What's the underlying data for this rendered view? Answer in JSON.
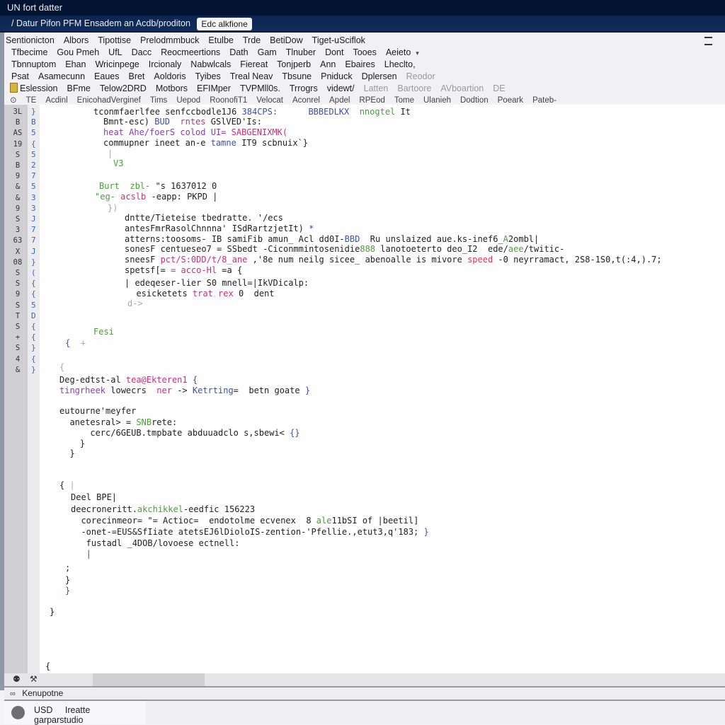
{
  "window": {
    "title": "UN fort datter",
    "path": "/ Datur Pifon PFM Ensadem an Acdb/proditon",
    "path_chip": "Edc alkfione"
  },
  "menus": {
    "row1": [
      "Sentionicton",
      "Albors",
      "Tipottise",
      "Prelodmmbuck",
      "Etulbe",
      "Trde",
      "BetiDow",
      "Tiget-uSciflok"
    ],
    "row2": [
      "Tfbecime",
      "Gou Pmeh",
      "UfL",
      "Dacc",
      "Reocmeertions",
      "Dath",
      "Gam",
      "Tlnuber",
      "Dont",
      "Tooes",
      "Aeieto"
    ],
    "row3": [
      "Tbnnuptom",
      "Ehan",
      "Wricinpege",
      "Ircionaly",
      "Nabwlcals",
      "Fiereat",
      "Tonjperb",
      "Ann",
      "Ebaires",
      "Lheclto,"
    ],
    "row4": [
      "Psat",
      "Asamecunn",
      "Eaues",
      "Bret",
      "Aoldoris",
      "Tyibes",
      "Treal Neav",
      "Tbsune",
      "Pniduck",
      "Dplersen"
    ],
    "row4_muted": [
      "Reodor"
    ],
    "row5": [
      "Eslession",
      "BFme",
      "Telow2DRD",
      "Motbors",
      "EFIMper",
      "TVPMll0s.",
      "Trrogrs",
      "videwt/"
    ],
    "row5_muted": [
      "Latten",
      "Bartoore",
      "AVboartion",
      "DE"
    ],
    "row6": [
      "TE",
      "Acdinl",
      "EnicohadVerginef",
      "Tims",
      "Uepod",
      "RoonofiT1",
      "Velocat",
      "Aconrel",
      "Apdel",
      "RPEod",
      "Tome",
      "Ulanieh",
      "Dodtion",
      "Poeark",
      "Pateb-"
    ]
  },
  "gutter": {
    "line_numbers": [
      "3L",
      "B",
      "AS",
      "19",
      "S",
      "B",
      "9",
      "&",
      "&",
      "9",
      "S",
      "3",
      "63",
      "X",
      "08",
      "S",
      "S",
      "9",
      "S",
      "T",
      "S",
      "+",
      "S",
      "4",
      "&"
    ]
  },
  "code": [
    {
      "id": "l1",
      "segments": [
        [
          "",
          "tconmfaerlfee senfccbodle1J6 "
        ],
        [
          "kw",
          "384CPS:"
        ],
        [
          "",
          "      "
        ],
        [
          "kw",
          "BBBEDLKX"
        ],
        [
          "",
          "  "
        ],
        [
          "gr",
          "nnogtel"
        ],
        [
          "",
          " It"
        ]
      ]
    },
    {
      "id": "l2",
      "segments": [
        [
          "",
          "Bmnt-esc) "
        ],
        [
          "kw",
          "BUD"
        ],
        [
          "",
          "  "
        ],
        [
          "pk",
          "rntes"
        ],
        [
          "",
          " GSlVED'Is:"
        ]
      ]
    },
    {
      "id": "l3",
      "segments": [
        [
          "pu",
          "heat Ahe/foerS colod UI= "
        ],
        [
          "pk",
          "SABGENIXMK("
        ]
      ]
    },
    {
      "id": "l4",
      "segments": [
        [
          "",
          "commupner ineet an-e "
        ],
        [
          "kw",
          "tamne"
        ],
        [
          "",
          " IT9 scbnuix`}"
        ]
      ]
    },
    {
      "id": "l5",
      "segments": [
        [
          "gy",
          "|"
        ]
      ]
    },
    {
      "id": "l6",
      "segments": [
        [
          "gr",
          "V3"
        ]
      ]
    },
    {
      "id": "l7",
      "segments": [
        [
          "gr",
          "Burt  zbl-"
        ],
        [
          "",
          " \"s 1637012 0"
        ]
      ]
    },
    {
      "id": "l8",
      "segments": [
        [
          "gr",
          "\"eg-"
        ],
        [
          "",
          ""
        ],
        [
          "pk",
          " acslb"
        ],
        [
          "",
          " -eapp: PKPD |"
        ]
      ]
    },
    {
      "id": "l9",
      "segments": [
        [
          "gy",
          "})"
        ]
      ]
    },
    {
      "id": "l10",
      "segments": [
        [
          "",
          "dntte/Tieteise tbedratte. '/ecs"
        ]
      ]
    },
    {
      "id": "l11",
      "segments": [
        [
          "",
          "antesFmrRasolChnnna' ISdRartzjetIt) "
        ],
        [
          "kw",
          "*"
        ]
      ]
    },
    {
      "id": "l12",
      "segments": [
        [
          "",
          "atterns:toosoms- IB samiFib amun_ Acl dd0I-"
        ],
        [
          "kw",
          "BBD"
        ],
        [
          "",
          "  Ru unslaized aue.ks-inef6_"
        ],
        [
          "gr",
          "A"
        ],
        [
          "",
          "2ombl|"
        ]
      ]
    },
    {
      "id": "l13",
      "segments": [
        [
          "",
          "sonesF centueseo7 = SSbedt -Ciconmmintosenidie"
        ],
        [
          "gr",
          "888"
        ],
        [
          "",
          " lanotoeterto deo_I2  ede/"
        ],
        [
          "gr",
          "aee"
        ],
        [
          "",
          "/twitic-"
        ]
      ]
    },
    {
      "id": "l14",
      "segments": [
        [
          "",
          "sneesF "
        ],
        [
          "pk",
          "pct/S:0DD/t/8_ane"
        ],
        [
          "",
          " ,'8e num neilg sicee_ abenoalle is mivore "
        ],
        [
          "rd",
          "speed"
        ],
        [
          "",
          " -0 neyrramact, 2S8-1S0,t(:4,).7;"
        ]
      ]
    },
    {
      "id": "l15",
      "segments": [
        [
          "",
          "spetsf[= "
        ],
        [
          "pk",
          "= acco-Hl"
        ],
        [
          "",
          " =a {"
        ]
      ]
    },
    {
      "id": "l16",
      "segments": [
        [
          "",
          "| edeqeser-lier S0 mnell=|IkVDicalp:"
        ]
      ]
    },
    {
      "id": "l17",
      "segments": [
        [
          "",
          "  esicketets "
        ],
        [
          "pk",
          "trat rex"
        ],
        [
          "",
          " 0  dent"
        ]
      ]
    },
    {
      "id": "l18",
      "segments": [
        [
          "gy",
          "d->"
        ]
      ]
    },
    {
      "id": "l19",
      "segments": [
        [
          "gr",
          "Fesi"
        ]
      ]
    },
    {
      "id": "l20",
      "segments": [
        [
          "kw",
          "{"
        ],
        [
          "",
          "  "
        ],
        [
          "gy",
          "+"
        ]
      ]
    },
    {
      "id": "l21",
      "segments": [
        [
          "gy",
          "{"
        ]
      ]
    },
    {
      "id": "l22",
      "segments": [
        [
          "",
          "Deg-edtst-al "
        ],
        [
          "pk",
          "tea@Ekteren1"
        ],
        [
          "",
          " "
        ],
        [
          "kw",
          "{"
        ]
      ]
    },
    {
      "id": "l23",
      "segments": [
        [
          "pu",
          "tingrheek"
        ],
        [
          "",
          " lowecrs  "
        ],
        [
          "pk",
          "ner"
        ],
        [
          "",
          " -> "
        ],
        [
          "kw",
          "Ketrting"
        ],
        [
          "",
          "=  betn goate "
        ],
        [
          "kw",
          "}"
        ]
      ]
    },
    {
      "id": "l24",
      "segments": [
        [
          "",
          "eutourne'meyfer"
        ]
      ]
    },
    {
      "id": "l25",
      "segments": [
        [
          "",
          "  anetesral> = "
        ],
        [
          "gr",
          "SNB"
        ],
        [
          "",
          "rete:"
        ]
      ]
    },
    {
      "id": "l26",
      "segments": [
        [
          "",
          "      cerc/6GEUB.tmpbate abduuadclo s,sbewi< "
        ],
        [
          "kw",
          "{}"
        ]
      ]
    },
    {
      "id": "l27",
      "segments": [
        [
          "",
          "    }"
        ]
      ]
    },
    {
      "id": "l28",
      "segments": [
        [
          "",
          "  }"
        ]
      ]
    },
    {
      "id": "l29",
      "segments": [
        [
          "",
          "{ "
        ],
        [
          "gy",
          "|"
        ]
      ]
    },
    {
      "id": "l30",
      "segments": [
        [
          "",
          "Deel BPE|"
        ]
      ]
    },
    {
      "id": "l31",
      "segments": [
        [
          "",
          "deecroneritt."
        ],
        [
          "gr",
          "akchikkel"
        ],
        [
          "",
          "-eedfic 156223"
        ]
      ]
    },
    {
      "id": "l32",
      "segments": [
        [
          "",
          "  corecinmeor= \"= Actioc=  endotolme ecvenex  8 "
        ],
        [
          "gr",
          "ale"
        ],
        [
          "",
          "11bSI of |beetil]"
        ]
      ]
    },
    {
      "id": "l33",
      "segments": [
        [
          "",
          "  -onet-=EUS&SfIiate atetsEJ6lDioloIS-zention-'Pfellie.,etut3,q'183; "
        ],
        [
          "kw",
          "}"
        ]
      ]
    },
    {
      "id": "l34",
      "segments": [
        [
          "",
          "   fustadl _4DOB/lovoese ectnell:"
        ]
      ]
    },
    {
      "id": "l35",
      "segments": [
        [
          "kw",
          "   |"
        ]
      ]
    },
    {
      "id": "l36",
      "segments": [
        [
          "",
          ";"
        ]
      ]
    },
    {
      "id": "l37",
      "segments": [
        [
          "",
          "}"
        ]
      ]
    },
    {
      "id": "l38",
      "segments": [
        [
          "kw",
          "}"
        ]
      ]
    },
    {
      "id": "l39",
      "segments": [
        [
          "",
          "}"
        ]
      ]
    },
    {
      "id": "l40",
      "segments": [
        [
          "",
          "{"
        ]
      ]
    }
  ],
  "panel": {
    "title": "Kenupotne"
  },
  "statusbar": {
    "items": [
      "USD",
      "Ireatte",
      "garparstudio"
    ]
  }
}
